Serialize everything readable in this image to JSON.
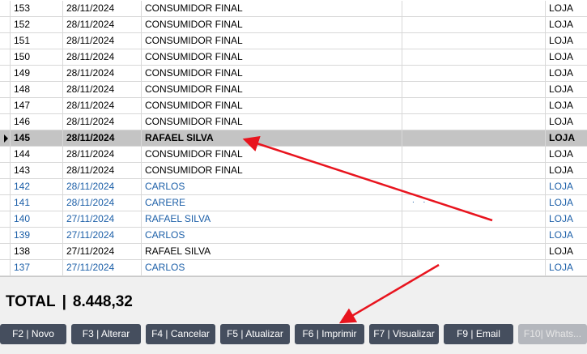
{
  "grid": {
    "rows": [
      {
        "id": "153",
        "date": "28/11/2024",
        "name": "CONSUMIDOR FINAL",
        "store": "LOJA",
        "style": "normal"
      },
      {
        "id": "152",
        "date": "28/11/2024",
        "name": "CONSUMIDOR FINAL",
        "store": "LOJA",
        "style": "normal"
      },
      {
        "id": "151",
        "date": "28/11/2024",
        "name": "CONSUMIDOR FINAL",
        "store": "LOJA",
        "style": "normal"
      },
      {
        "id": "150",
        "date": "28/11/2024",
        "name": "CONSUMIDOR FINAL",
        "store": "LOJA",
        "style": "normal"
      },
      {
        "id": "149",
        "date": "28/11/2024",
        "name": "CONSUMIDOR FINAL",
        "store": "LOJA",
        "style": "normal"
      },
      {
        "id": "148",
        "date": "28/11/2024",
        "name": "CONSUMIDOR FINAL",
        "store": "LOJA",
        "style": "normal"
      },
      {
        "id": "147",
        "date": "28/11/2024",
        "name": "CONSUMIDOR FINAL",
        "store": "LOJA",
        "style": "normal"
      },
      {
        "id": "146",
        "date": "28/11/2024",
        "name": "CONSUMIDOR FINAL",
        "store": "LOJA",
        "style": "normal"
      },
      {
        "id": "145",
        "date": "28/11/2024",
        "name": "RAFAEL SILVA",
        "store": "LOJA",
        "style": "selected"
      },
      {
        "id": "144",
        "date": "28/11/2024",
        "name": "CONSUMIDOR FINAL",
        "store": "LOJA",
        "style": "normal"
      },
      {
        "id": "143",
        "date": "28/11/2024",
        "name": "CONSUMIDOR FINAL",
        "store": "LOJA",
        "style": "normal"
      },
      {
        "id": "142",
        "date": "28/11/2024",
        "name": "CARLOS",
        "store": "LOJA",
        "style": "blue"
      },
      {
        "id": "141",
        "date": "28/11/2024",
        "name": "CARERE",
        "store": "LOJA",
        "style": "blue"
      },
      {
        "id": "140",
        "date": "27/11/2024",
        "name": "RAFAEL SILVA",
        "store": "LOJA",
        "style": "blue"
      },
      {
        "id": "139",
        "date": "27/11/2024",
        "name": "CARLOS",
        "store": "LOJA",
        "style": "blue"
      },
      {
        "id": "138",
        "date": "27/11/2024",
        "name": "RAFAEL SILVA",
        "store": "LOJA",
        "style": "normal"
      },
      {
        "id": "137",
        "date": "27/11/2024",
        "name": "CARLOS",
        "store": "LOJA",
        "style": "blue"
      }
    ]
  },
  "total": {
    "label": "TOTAL",
    "separator": "|",
    "value": "8.448,32"
  },
  "toolbar": {
    "buttons": [
      {
        "label": "F2 | Novo",
        "disabled": false
      },
      {
        "label": "F3 | Alterar",
        "disabled": false
      },
      {
        "label": "F4 | Cancelar",
        "disabled": false
      },
      {
        "label": "F5 | Atualizar",
        "disabled": false
      },
      {
        "label": "F6 | Imprimir",
        "disabled": false
      },
      {
        "label": "F7 | Visualizar",
        "disabled": false
      },
      {
        "label": "F9 | Email",
        "disabled": false
      },
      {
        "label": "F10| Whats...",
        "disabled": true
      }
    ]
  },
  "annotation": {
    "arrow_color": "#e8141e"
  },
  "colors": {
    "selected_row": "#c4c4c4",
    "link_text": "#1c5fa8",
    "button": "#454e5e"
  }
}
